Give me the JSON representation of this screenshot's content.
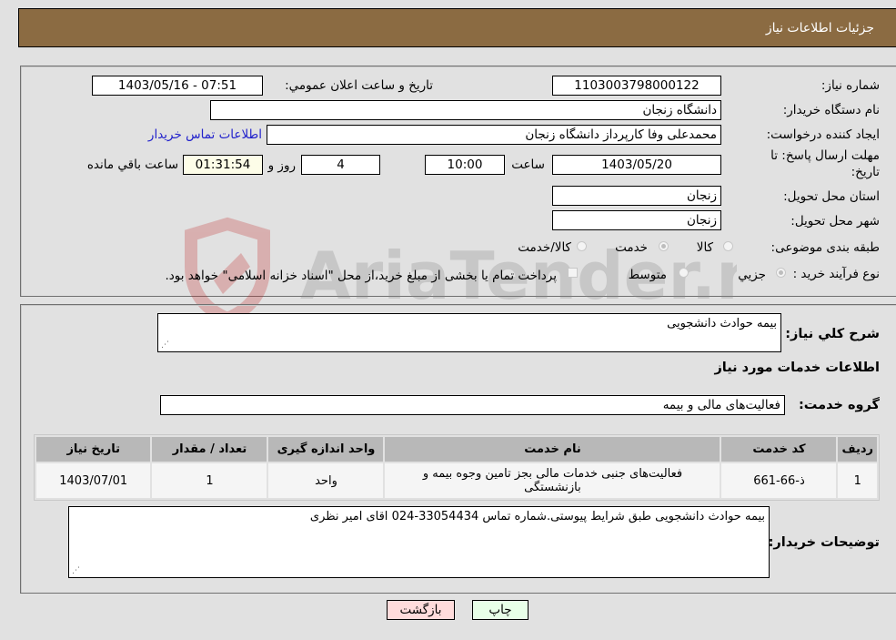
{
  "header": {
    "title": "جزئیات اطلاعات نیاز"
  },
  "details": {
    "need_number_label": "شماره نیاز:",
    "need_number": "1103003798000122",
    "announce_label": "تاریخ و ساعت اعلان عمومي:",
    "announce_value": "1403/05/16 - 07:51",
    "buyer_org_label": "نام دستگاه خریدار:",
    "buyer_org": "دانشگاه زنجان",
    "creator_label": "ایجاد کننده درخواست:",
    "creator": "محمدعلی وفا کارپرداز دانشگاه زنجان",
    "contact_link": "اطلاعات تماس خریدار",
    "deadline_label_line1": "مهلت ارسال پاسخ: تا",
    "deadline_label_line2": "تاریخ:",
    "deadline_date": "1403/05/20",
    "time_label": "ساعت",
    "deadline_time": "10:00",
    "days_value": "4",
    "days_label": "روز و",
    "remaining_time": "01:31:54",
    "remaining_label": "ساعت باقي مانده",
    "province_label": "استان محل تحویل:",
    "province": "زنجان",
    "city_label": "شهر محل تحویل:",
    "city": "زنجان",
    "category_label": "طبقه بندی موضوعی:",
    "category_options": [
      {
        "label": "کالا",
        "checked": false
      },
      {
        "label": "خدمت",
        "checked": true
      },
      {
        "label": "کالا/خدمت",
        "checked": false
      }
    ],
    "process_label": "نوع فرآیند خرید :",
    "process_options": [
      {
        "label": "جزيي",
        "checked": true
      },
      {
        "label": "متوسط",
        "checked": false
      }
    ],
    "treasury_note": "پرداخت تمام یا بخشی از مبلغ خرید،از محل \"اسناد خزانه اسلامی\" خواهد بود."
  },
  "summary": {
    "general_desc_label": "شرح کلي نیاز:",
    "general_desc": "بیمه حوادث دانشجویی",
    "services_heading": "اطلاعات خدمات مورد نیاز",
    "service_group_label": "گروه خدمت:",
    "service_group": "فعالیت‌های مالی و بیمه"
  },
  "table": {
    "headers": [
      "ردیف",
      "کد خدمت",
      "نام خدمت",
      "واحد اندازه گیری",
      "تعداد / مقدار",
      "تاریخ نیاز"
    ],
    "rows": [
      [
        "1",
        "ذ-66-661",
        "فعالیت‌های جنبی خدمات مالی بجز تامین وجوه بیمه و بازنشستگی",
        "واحد",
        "1",
        "1403/07/01"
      ]
    ]
  },
  "buyer_notes": {
    "label": "توضیحات خریدار:",
    "text": "بیمه حوادث دانشجویی طبق شرایط پیوستی.شماره تماس 33054434-024 اقای امیر نظری"
  },
  "buttons": {
    "print": "چاپ",
    "back": "بازگشت"
  },
  "watermark": {
    "text": "AriaTender.neT"
  },
  "colors": {
    "header_bg": "#8b6b42",
    "link": "#2222cc",
    "print_bg": "#e8ffe8",
    "back_bg": "#ffdcdc"
  }
}
